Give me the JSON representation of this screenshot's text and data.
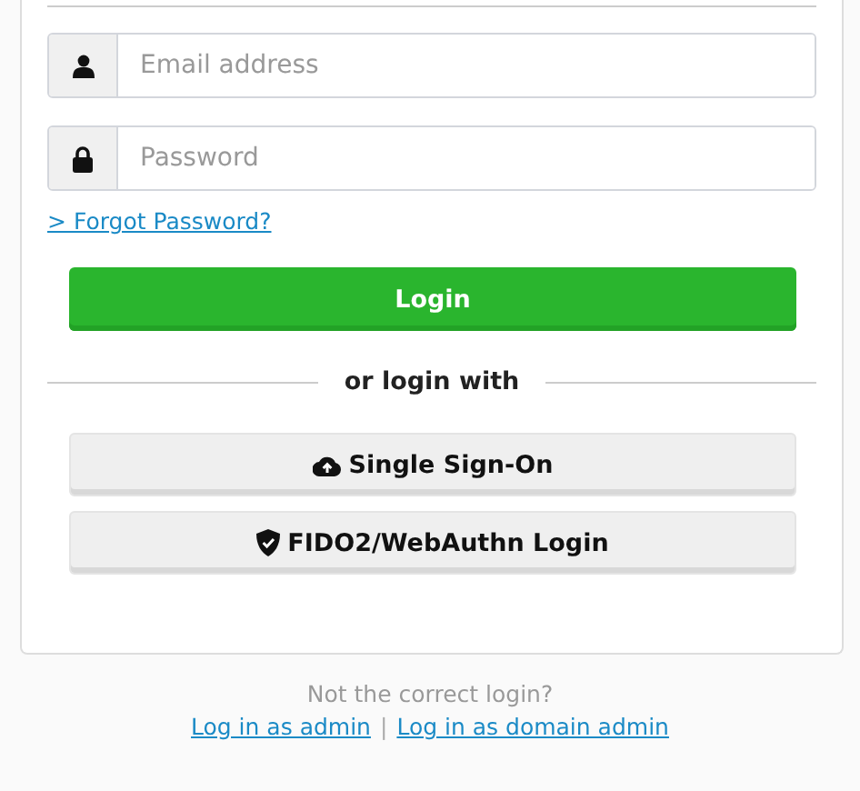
{
  "login_form": {
    "email": {
      "placeholder": "Email address"
    },
    "password": {
      "placeholder": "Password"
    },
    "forgot_link": "> Forgot Password?",
    "login_button": "Login",
    "divider_text": "or login with",
    "alt_logins": [
      {
        "kind": "sso",
        "label": "Single Sign-On"
      },
      {
        "kind": "fido",
        "label": "FIDO2/WebAuthn Login"
      }
    ]
  },
  "footer": {
    "question": "Not the correct login?",
    "links": [
      "Log in as admin",
      "Log in as domain admin"
    ],
    "separator": "|"
  }
}
